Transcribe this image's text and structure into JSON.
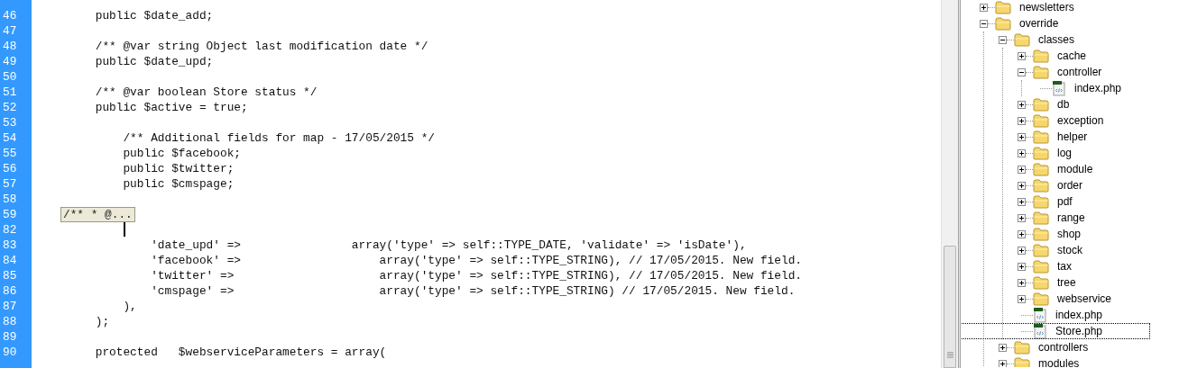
{
  "editor": {
    "lines": [
      {
        "number": "46",
        "text": "    public $date_add;"
      },
      {
        "number": "47"
      },
      {
        "number": "48",
        "text": "    /** @var string Object last modification date */"
      },
      {
        "number": "49",
        "text": "    public $date_upd;"
      },
      {
        "number": "50"
      },
      {
        "number": "51",
        "text": "    /** @var boolean Store status */"
      },
      {
        "number": "52",
        "text": "    public $active = true;"
      },
      {
        "number": "53"
      },
      {
        "number": "54",
        "text": "        /** Additional fields for map - 17/05/2015 */"
      },
      {
        "number": "55",
        "text": "        public $facebook;"
      },
      {
        "number": "56",
        "text": "        public $twitter;"
      },
      {
        "number": "57",
        "text": "        public $cmspage;"
      },
      {
        "number": "58"
      },
      {
        "number": "59",
        "kind": "fold",
        "text": "/** * @..."
      },
      {
        "number": "82"
      },
      {
        "number": "83",
        "text": "            'date_upd' =>                array('type' => self::TYPE_DATE, 'validate' => 'isDate'),"
      },
      {
        "number": "84",
        "text": "            'facebook' =>                    array('type' => self::TYPE_STRING), // 17/05/2015. New field."
      },
      {
        "number": "85",
        "text": "            'twitter' =>                     array('type' => self::TYPE_STRING), // 17/05/2015. New field."
      },
      {
        "number": "86",
        "text": "            'cmspage' =>                     array('type' => self::TYPE_STRING) // 17/05/2015. New field."
      },
      {
        "number": "87",
        "text": "        ),"
      },
      {
        "number": "88",
        "text": "    );"
      },
      {
        "number": "89"
      },
      {
        "number": "90",
        "text": "    protected   $webserviceParameters = array("
      }
    ]
  },
  "file_tree": {
    "items": [
      {
        "kind": "folder",
        "label": "newsletters",
        "expanded": false,
        "selected": false
      },
      {
        "kind": "folder",
        "label": "override",
        "expanded": true,
        "selected": false,
        "children": [
          {
            "kind": "folder",
            "label": "classes",
            "expanded": true,
            "selected": false,
            "children": [
              {
                "kind": "folder",
                "label": "cache",
                "expanded": false,
                "selected": false
              },
              {
                "kind": "folder",
                "label": "controller",
                "expanded": true,
                "selected": false,
                "children": [
                  {
                    "kind": "file",
                    "label": "index.php",
                    "selected": false
                  }
                ]
              },
              {
                "kind": "folder",
                "label": "db",
                "expanded": false,
                "selected": false
              },
              {
                "kind": "folder",
                "label": "exception",
                "expanded": false,
                "selected": false
              },
              {
                "kind": "folder",
                "label": "helper",
                "expanded": false,
                "selected": false
              },
              {
                "kind": "folder",
                "label": "log",
                "expanded": false,
                "selected": false
              },
              {
                "kind": "folder",
                "label": "module",
                "expanded": false,
                "selected": false
              },
              {
                "kind": "folder",
                "label": "order",
                "expanded": false,
                "selected": false
              },
              {
                "kind": "folder",
                "label": "pdf",
                "expanded": false,
                "selected": false
              },
              {
                "kind": "folder",
                "label": "range",
                "expanded": false,
                "selected": false
              },
              {
                "kind": "folder",
                "label": "shop",
                "expanded": false,
                "selected": false
              },
              {
                "kind": "folder",
                "label": "stock",
                "expanded": false,
                "selected": false
              },
              {
                "kind": "folder",
                "label": "tax",
                "expanded": false,
                "selected": false
              },
              {
                "kind": "folder",
                "label": "tree",
                "expanded": false,
                "selected": false
              },
              {
                "kind": "folder",
                "label": "webservice",
                "expanded": false,
                "selected": false
              },
              {
                "kind": "file",
                "label": "index.php",
                "selected": false
              },
              {
                "kind": "file",
                "label": "Store.php",
                "selected": true
              }
            ]
          },
          {
            "kind": "folder",
            "label": "controllers",
            "expanded": false,
            "selected": false
          },
          {
            "kind": "folder",
            "label": "modules",
            "expanded": false,
            "selected": false
          }
        ]
      }
    ]
  }
}
